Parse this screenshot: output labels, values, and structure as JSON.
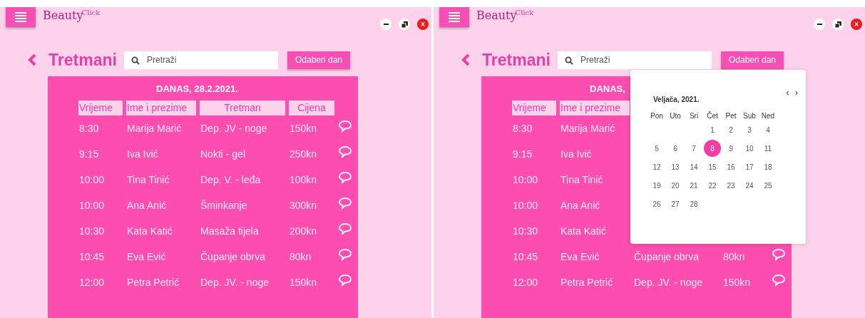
{
  "screens": [
    {
      "logo": {
        "main": "Beauty",
        "sup": "Click"
      },
      "window_controls": {
        "close_label": "X"
      },
      "page_title": "Tretmani",
      "search": {
        "placeholder": "Pretraži"
      },
      "pick_day_button": "Odaberi dan",
      "table": {
        "title": "DANAS, 28.2.2021.",
        "columns": [
          "Vrijeme",
          "Ime i prezime",
          "Tretman",
          "Cijena"
        ],
        "rows": [
          {
            "time": "8:30",
            "name": "Marija Marić",
            "treatment": "Dep. JV - noge",
            "price": "150kn"
          },
          {
            "time": "9:15",
            "name": "Iva Ivić",
            "treatment": "Nokti - gel",
            "price": "250kn"
          },
          {
            "time": "10:00",
            "name": "Tina Tinić",
            "treatment": "Dep. V. - leđa",
            "price": "100kn"
          },
          {
            "time": "10:00",
            "name": "Ana Anić",
            "treatment": "Šminkanje",
            "price": "300kn"
          },
          {
            "time": "10:30",
            "name": "Kata Katić",
            "treatment": "Masaža tijela",
            "price": "200kn"
          },
          {
            "time": "10:45",
            "name": "Eva Ević",
            "treatment": "Čupanje obrva",
            "price": "80kn"
          },
          {
            "time": "12:00",
            "name": "Petra Petrić",
            "treatment": "Dep. JV. - noge",
            "price": "150kn"
          }
        ]
      }
    },
    {
      "logo": {
        "main": "Beauty",
        "sup": "Click"
      },
      "window_controls": {
        "close_label": "X"
      },
      "page_title": "Tretmani",
      "search": {
        "placeholder": "Pretraži"
      },
      "pick_day_button": "Odaberi dan",
      "table": {
        "title": "DANAS,",
        "columns": [
          "Vrijeme",
          "Ime i prezime"
        ],
        "rows": [
          {
            "time": "8:30",
            "name": "Marija Marić"
          },
          {
            "time": "9:15",
            "name": "Iva Ivić"
          },
          {
            "time": "10:00",
            "name": "Tina Tinić"
          },
          {
            "time": "10:00",
            "name": "Ana Anić"
          },
          {
            "time": "10:30",
            "name": "Kata Katić"
          },
          {
            "time": "10:45",
            "name": "Eva Ević",
            "treatment": "Čupanje obrva",
            "price": "80kn"
          },
          {
            "time": "12:00",
            "name": "Petra Petrić",
            "treatment": "Dep. JV. - noge",
            "price": "150kn"
          }
        ]
      },
      "calendar": {
        "month": "Veljača, 2021.",
        "prev": "‹",
        "next": "›",
        "weekdays": [
          "Pon",
          "Uto",
          "Sri",
          "Čet",
          "Pet",
          "Sub",
          "Ned"
        ],
        "weeks": [
          [
            {
              "day": "1",
              "selected": false
            },
            {
              "day": "2",
              "selected": false
            },
            {
              "day": "3",
              "selected": false
            },
            {
              "day": "4",
              "selected": false
            }
          ],
          [
            {
              "day": "5",
              "selected": false
            },
            {
              "day": "6",
              "selected": false
            },
            {
              "day": "7",
              "selected": false
            },
            {
              "day": "8",
              "selected": true
            },
            {
              "day": "9",
              "selected": false
            },
            {
              "day": "10",
              "selected": false
            },
            {
              "day": "11",
              "selected": false
            }
          ],
          [
            {
              "day": "12",
              "selected": false
            },
            {
              "day": "13",
              "selected": false
            },
            {
              "day": "14",
              "selected": false
            },
            {
              "day": "15",
              "selected": false
            },
            {
              "day": "16",
              "selected": false
            },
            {
              "day": "17",
              "selected": false
            },
            {
              "day": "18",
              "selected": false
            }
          ],
          [
            {
              "day": "19",
              "selected": false
            },
            {
              "day": "20",
              "selected": false
            },
            {
              "day": "21",
              "selected": false
            },
            {
              "day": "22",
              "selected": false
            },
            {
              "day": "23",
              "selected": false
            },
            {
              "day": "24",
              "selected": false
            },
            {
              "day": "25",
              "selected": false
            }
          ],
          [
            {
              "day": "26",
              "selected": false
            },
            {
              "day": "27",
              "selected": false
            },
            {
              "day": "28",
              "selected": false
            }
          ]
        ]
      }
    }
  ]
}
